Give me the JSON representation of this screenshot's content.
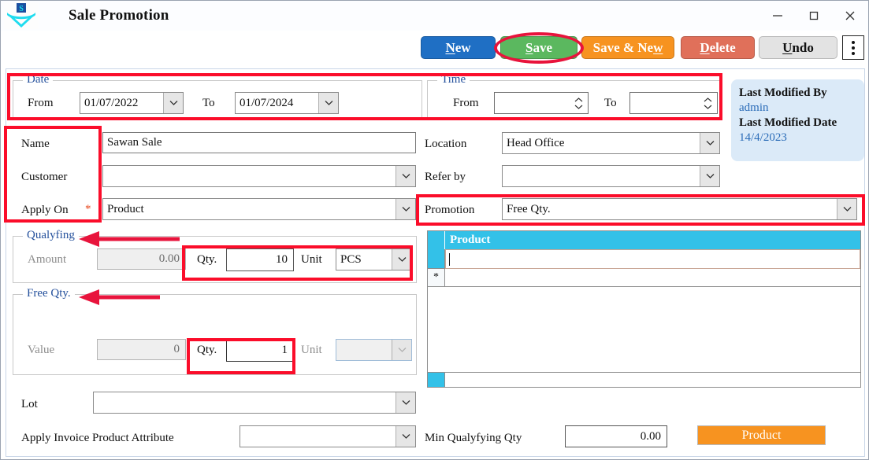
{
  "window": {
    "title": "Sale Promotion",
    "logo_icon": "app-logo-icon",
    "minimize_icon": "minimize-icon",
    "maximize_icon": "maximize-icon",
    "close_icon": "close-icon"
  },
  "toolbar": {
    "new_label": "New",
    "save_label": "Save",
    "save_new_label": "Save & New",
    "delete_label": "Delete",
    "undo_label": "Undo",
    "overflow_icon": "vertical-ellipsis-icon",
    "colors": {
      "new": "#1f6fc4",
      "save": "#5bb85f",
      "save_new": "#f79320",
      "delete": "#e0705a",
      "undo": "#e3e3e3"
    }
  },
  "date_group": {
    "legend": "Date",
    "from_label": "From",
    "from_value": "01/07/2022",
    "to_label": "To",
    "to_value": "01/07/2024"
  },
  "time_group": {
    "legend": "Time",
    "from_label": "From",
    "from_value": "",
    "to_label": "To",
    "to_value": ""
  },
  "info_panel": {
    "modified_by_label": "Last Modified By",
    "modified_by_value": "admin",
    "modified_date_label": "Last Modified Date",
    "modified_date_value": "14/4/2023"
  },
  "fields": {
    "name_label": "Name",
    "name_value": "Sawan Sale",
    "customer_label": "Customer",
    "customer_value": "",
    "apply_on_label": "Apply On",
    "apply_on_required": "*",
    "apply_on_value": "Product",
    "location_label": "Location",
    "location_value": "Head Office",
    "refer_by_label": "Refer by",
    "refer_by_value": "",
    "promotion_label": "Promotion",
    "promotion_value": "Free Qty.",
    "lot_label": "Lot",
    "lot_value": "",
    "apply_invoice_label": "Apply Invoice Product Attribute",
    "apply_invoice_value": ""
  },
  "qualifying_group": {
    "legend": "Qualyfing",
    "amount_label": "Amount",
    "amount_value": "0.00",
    "qty_label": "Qty.",
    "qty_value": "10",
    "unit_label": "Unit",
    "unit_value": "PCS"
  },
  "free_qty_group": {
    "legend": "Free Qty.",
    "value_label": "Value",
    "value_value": "0",
    "qty_label": "Qty.",
    "qty_value": "1",
    "unit_label": "Unit",
    "unit_value": ""
  },
  "grid": {
    "column_header": "Product",
    "rows": [
      {
        "marker": "",
        "product": ""
      }
    ],
    "new_row_marker": "*",
    "header_color": "#33c1e8"
  },
  "footer": {
    "min_qty_label": "Min Qualyfying Qty",
    "min_qty_value": "0.00",
    "product_button_label": "Product",
    "product_button_color": "#f79320"
  },
  "annotations": {
    "highlight_color": "#fb0d2a",
    "save_ellipse": "save-button-highlight",
    "date_box": "date-time-highlight",
    "name_box": "name-customer-applyon-highlight",
    "promotion_box": "promotion-highlight",
    "qualifying_qty_box": "qualifying-qty-highlight",
    "free_qty_box": "free-qty-highlight",
    "qualifying_arrow": "qualifying-arrow",
    "free_qty_arrow": "free-qty-arrow"
  }
}
